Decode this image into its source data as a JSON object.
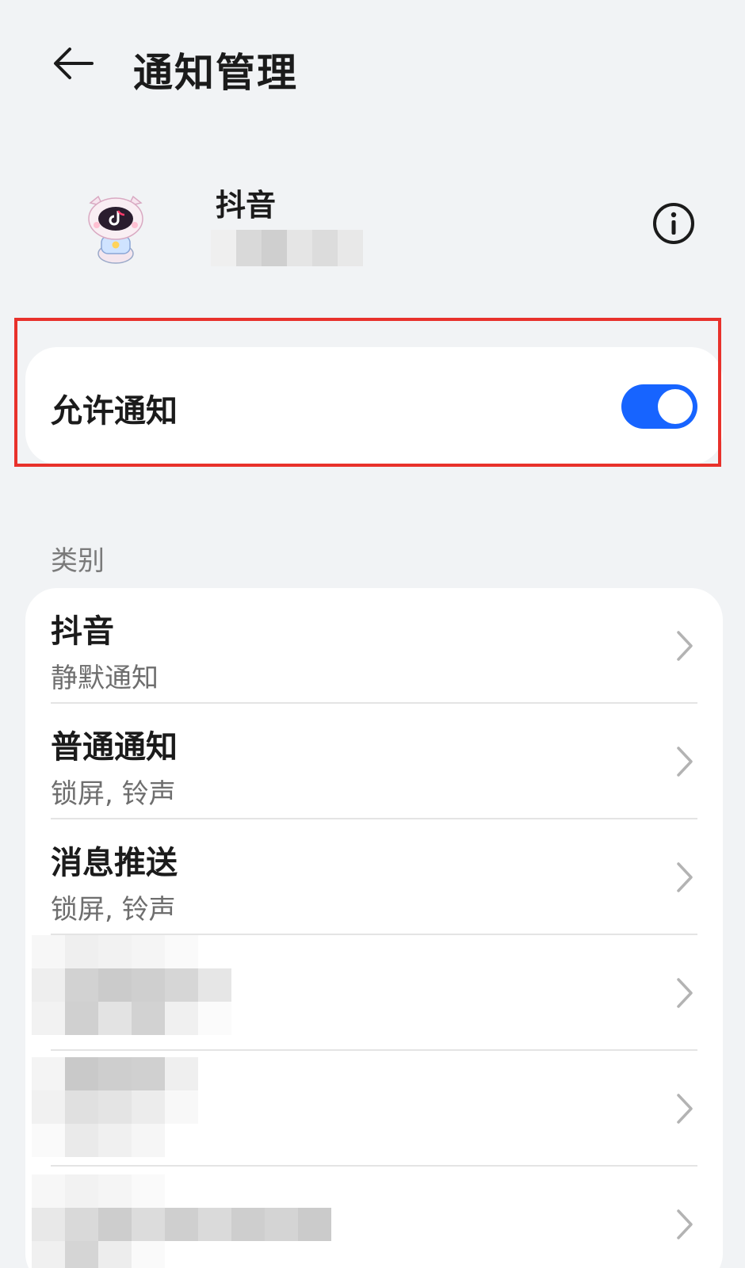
{
  "header": {
    "title": "通知管理"
  },
  "app": {
    "name": "抖音"
  },
  "allow": {
    "label": "允许通知",
    "enabled": true,
    "accent": "#1764ff"
  },
  "category": {
    "section_label": "类别",
    "items": [
      {
        "title": "抖音",
        "subtitle": "静默通知"
      },
      {
        "title": "普通通知",
        "subtitle": "锁屏, 铃声"
      },
      {
        "title": "消息推送",
        "subtitle": "锁屏, 铃声"
      }
    ]
  },
  "highlight_color": "#e8312b"
}
